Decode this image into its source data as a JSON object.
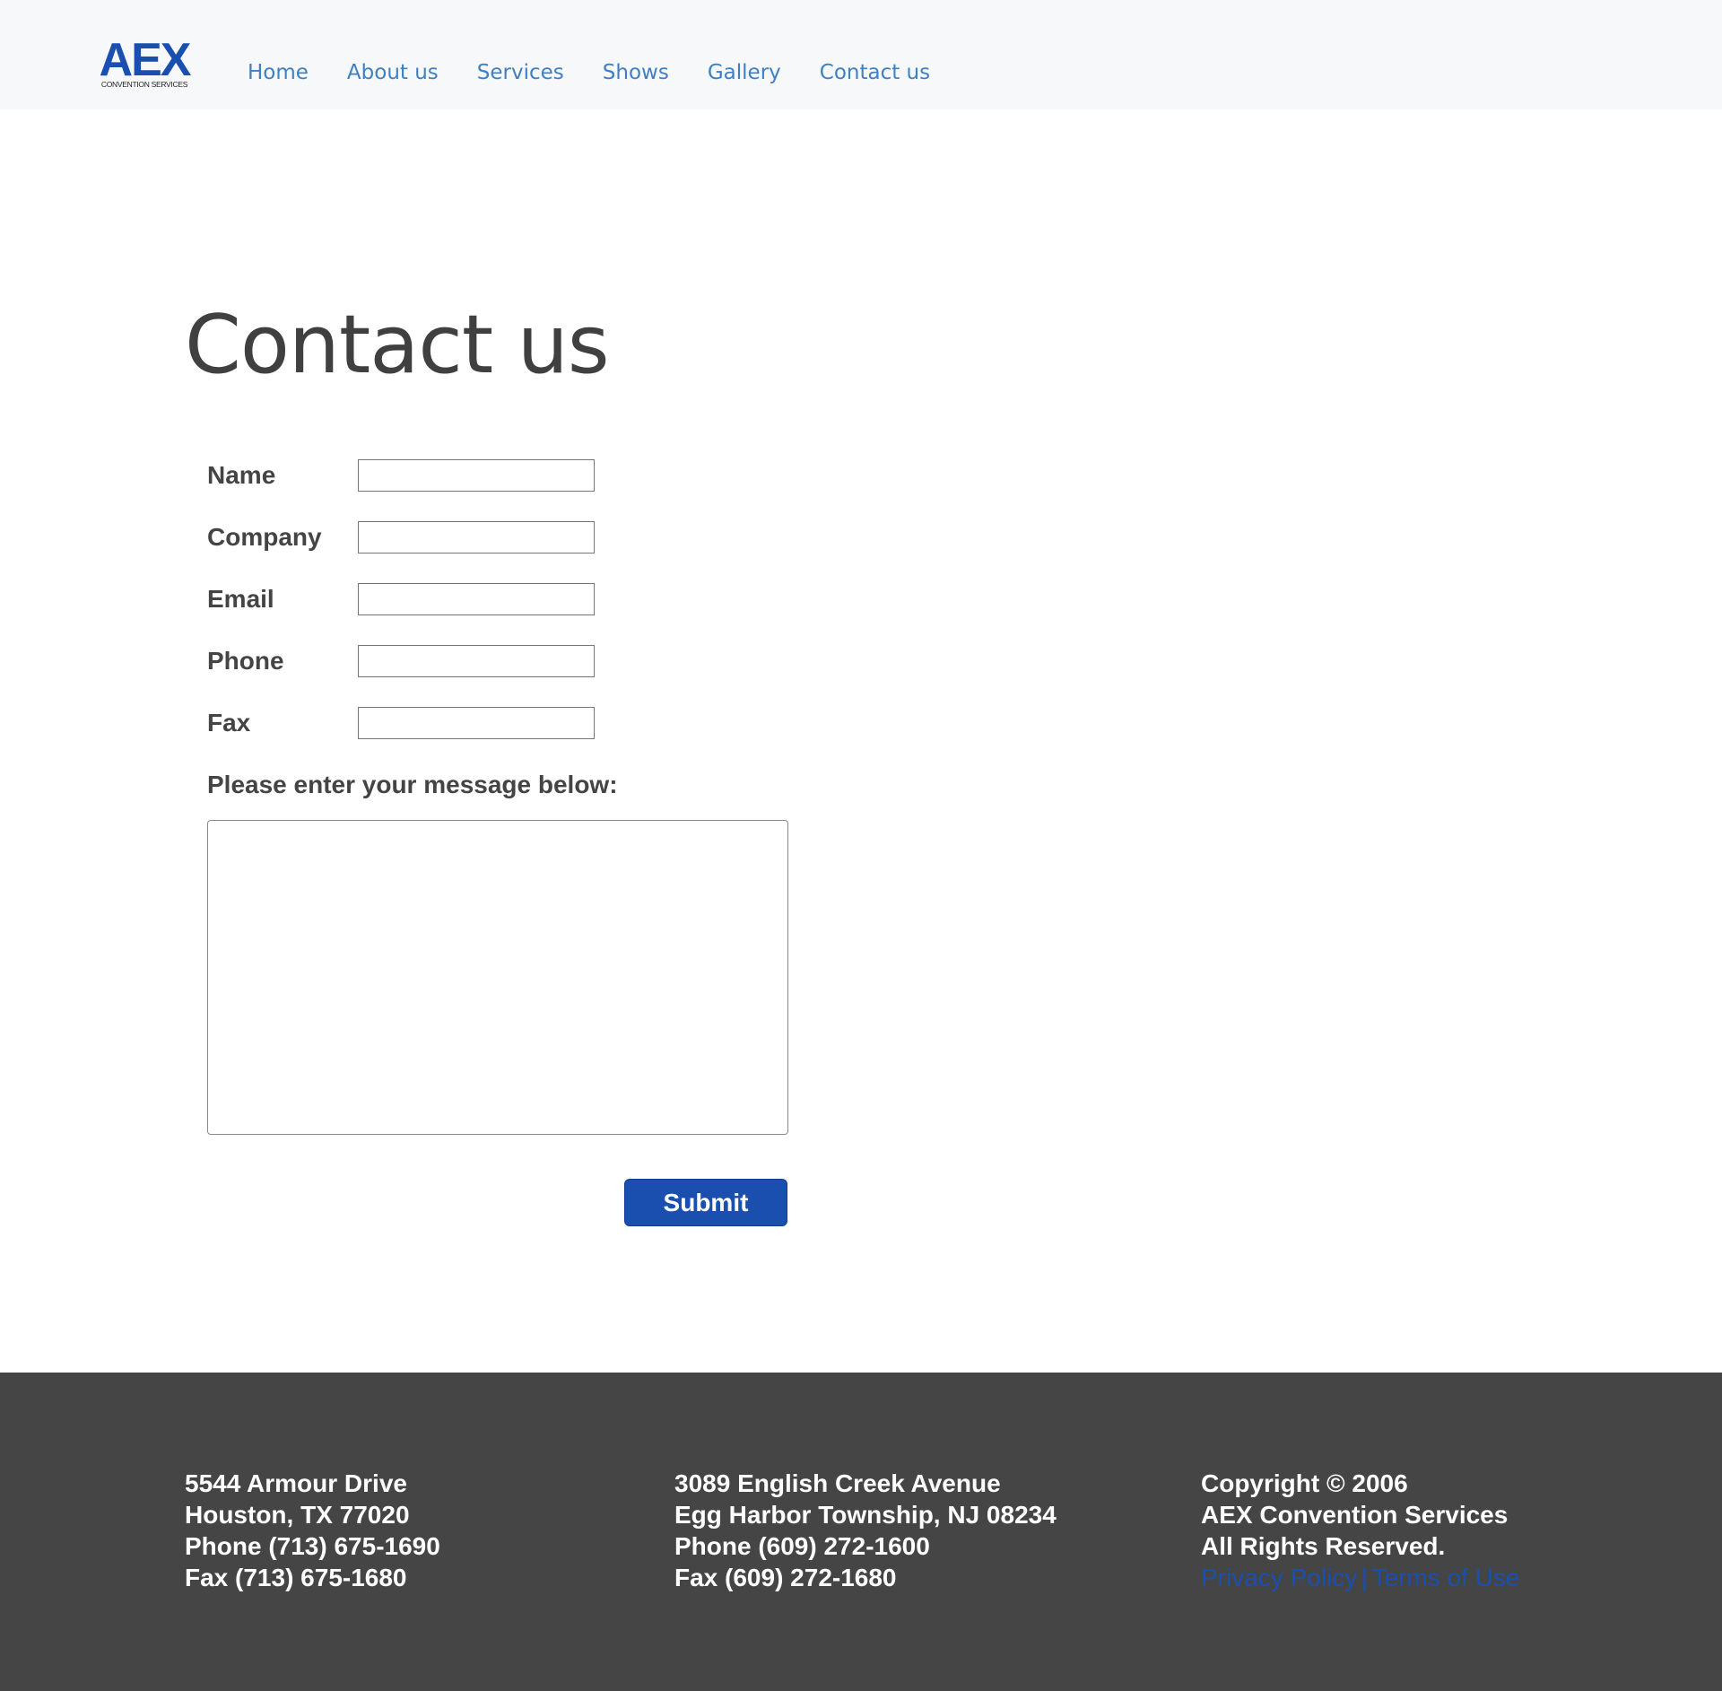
{
  "brand": {
    "logo_main": "AEX",
    "logo_sub": "CONVENTION SERVICES",
    "accent_color": "#1a4fb0"
  },
  "nav": {
    "items": [
      {
        "label": "Home"
      },
      {
        "label": "About us"
      },
      {
        "label": "Services"
      },
      {
        "label": "Shows"
      },
      {
        "label": "Gallery"
      },
      {
        "label": "Contact us"
      }
    ],
    "link_color": "#3f80c4"
  },
  "main": {
    "title": "Contact us",
    "fields": [
      {
        "label": "Name",
        "value": ""
      },
      {
        "label": "Company",
        "value": ""
      },
      {
        "label": "Email",
        "value": ""
      },
      {
        "label": "Phone",
        "value": ""
      },
      {
        "label": "Fax",
        "value": ""
      }
    ],
    "message_label": "Please enter your message below:",
    "message_value": "",
    "submit_label": "Submit"
  },
  "footer": {
    "background": "#454545",
    "houston": {
      "street": "5544 Armour Drive",
      "city": "Houston, TX 77020",
      "phone": "Phone (713) 675-1690",
      "fax": "Fax (713) 675-1680"
    },
    "egg_harbor": {
      "street": "3089 English Creek Avenue",
      "city": "Egg Harbor Township, NJ 08234",
      "phone": "Phone (609) 272-1600",
      "fax": "Fax (609) 272-1680"
    },
    "legal": {
      "copyright": "Copyright © 2006",
      "company": "AEX Convention Services",
      "rights": "All Rights Reserved.",
      "privacy": "Privacy Policy",
      "separator": "|",
      "terms": "Terms of Use"
    }
  }
}
